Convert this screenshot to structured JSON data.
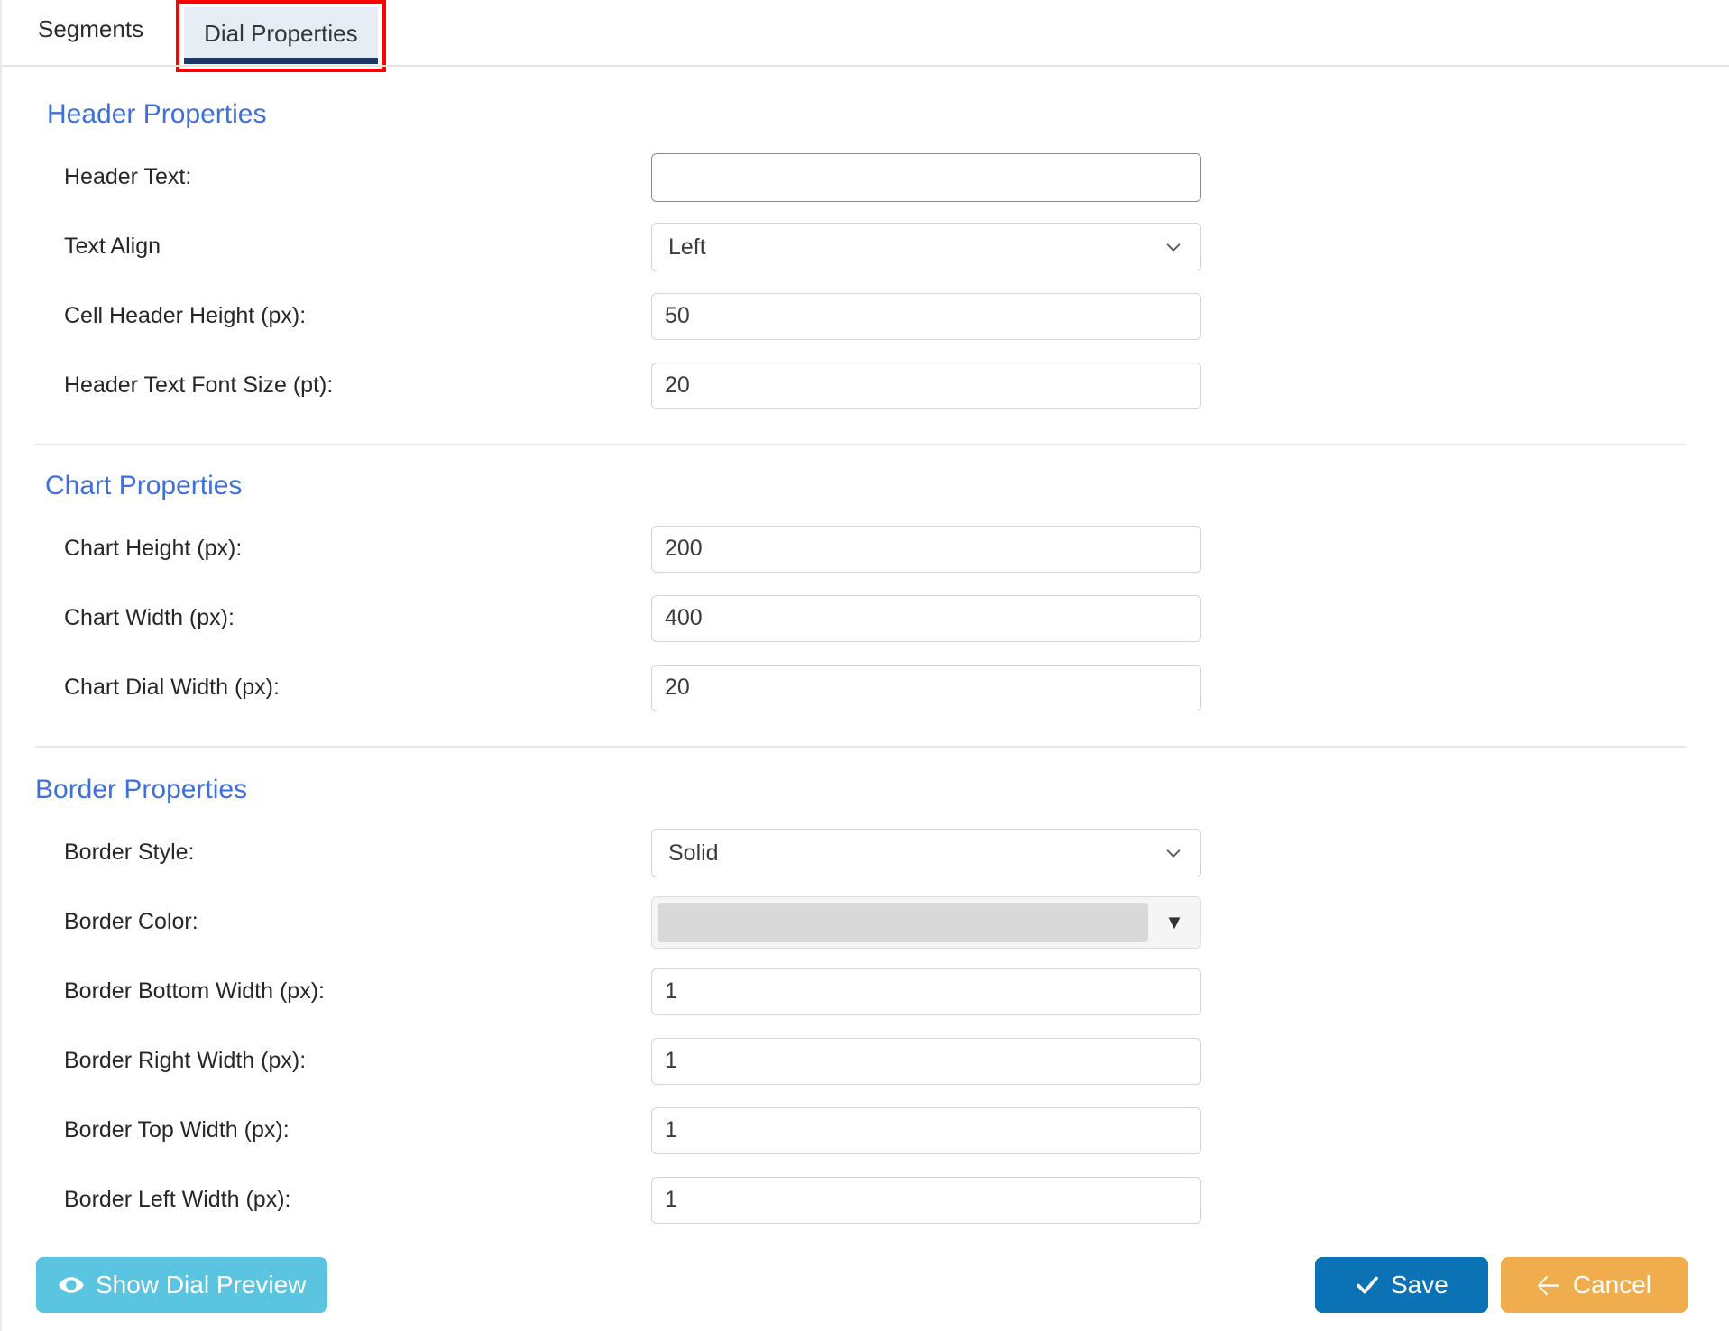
{
  "tabs": [
    {
      "label": "Segments",
      "active": false
    },
    {
      "label": "Dial Properties",
      "active": true
    }
  ],
  "sections": {
    "header": {
      "title": "Header Properties",
      "fields": {
        "header_text": {
          "label": "Header Text:",
          "value": "",
          "placeholder": ""
        },
        "text_align": {
          "label": "Text Align",
          "value": "Left"
        },
        "cell_header_h": {
          "label": "Cell Header Height (px):",
          "value": "50"
        },
        "header_font_size": {
          "label": "Header Text Font Size (pt):",
          "value": "20"
        }
      }
    },
    "chart": {
      "title": "Chart Properties",
      "fields": {
        "chart_height": {
          "label": "Chart Height (px):",
          "value": "200"
        },
        "chart_width": {
          "label": "Chart Width (px):",
          "value": "400"
        },
        "chart_dial_width": {
          "label": "Chart Dial Width (px):",
          "value": "20"
        }
      }
    },
    "border": {
      "title": "Border Properties",
      "fields": {
        "border_style": {
          "label": "Border Style:",
          "value": "Solid"
        },
        "border_color": {
          "label": "Border Color:",
          "value": "#d9d9d9"
        },
        "border_bottom": {
          "label": "Border Bottom Width (px):",
          "value": "1"
        },
        "border_right": {
          "label": "Border Right Width (px):",
          "value": "1"
        },
        "border_top": {
          "label": "Border Top Width (px):",
          "value": "1"
        },
        "border_left": {
          "label": "Border Left Width (px):",
          "value": "1"
        }
      }
    }
  },
  "footer": {
    "preview_label": "Show Dial Preview",
    "save_label": "Save",
    "cancel_label": "Cancel",
    "preview_icon": "eye-icon",
    "save_icon": "check-icon",
    "cancel_icon": "arrow-left-icon"
  },
  "colors": {
    "section_title": "#3f6fd8",
    "tab_active_bg": "#e6edf4",
    "tab_underline": "#1f3864",
    "highlight_box": "#ff0000",
    "preview_button": "#5bc4e0",
    "save_button": "#0b72b5",
    "cancel_button": "#f0ad4e",
    "swatch": "#d9d9d9"
  }
}
